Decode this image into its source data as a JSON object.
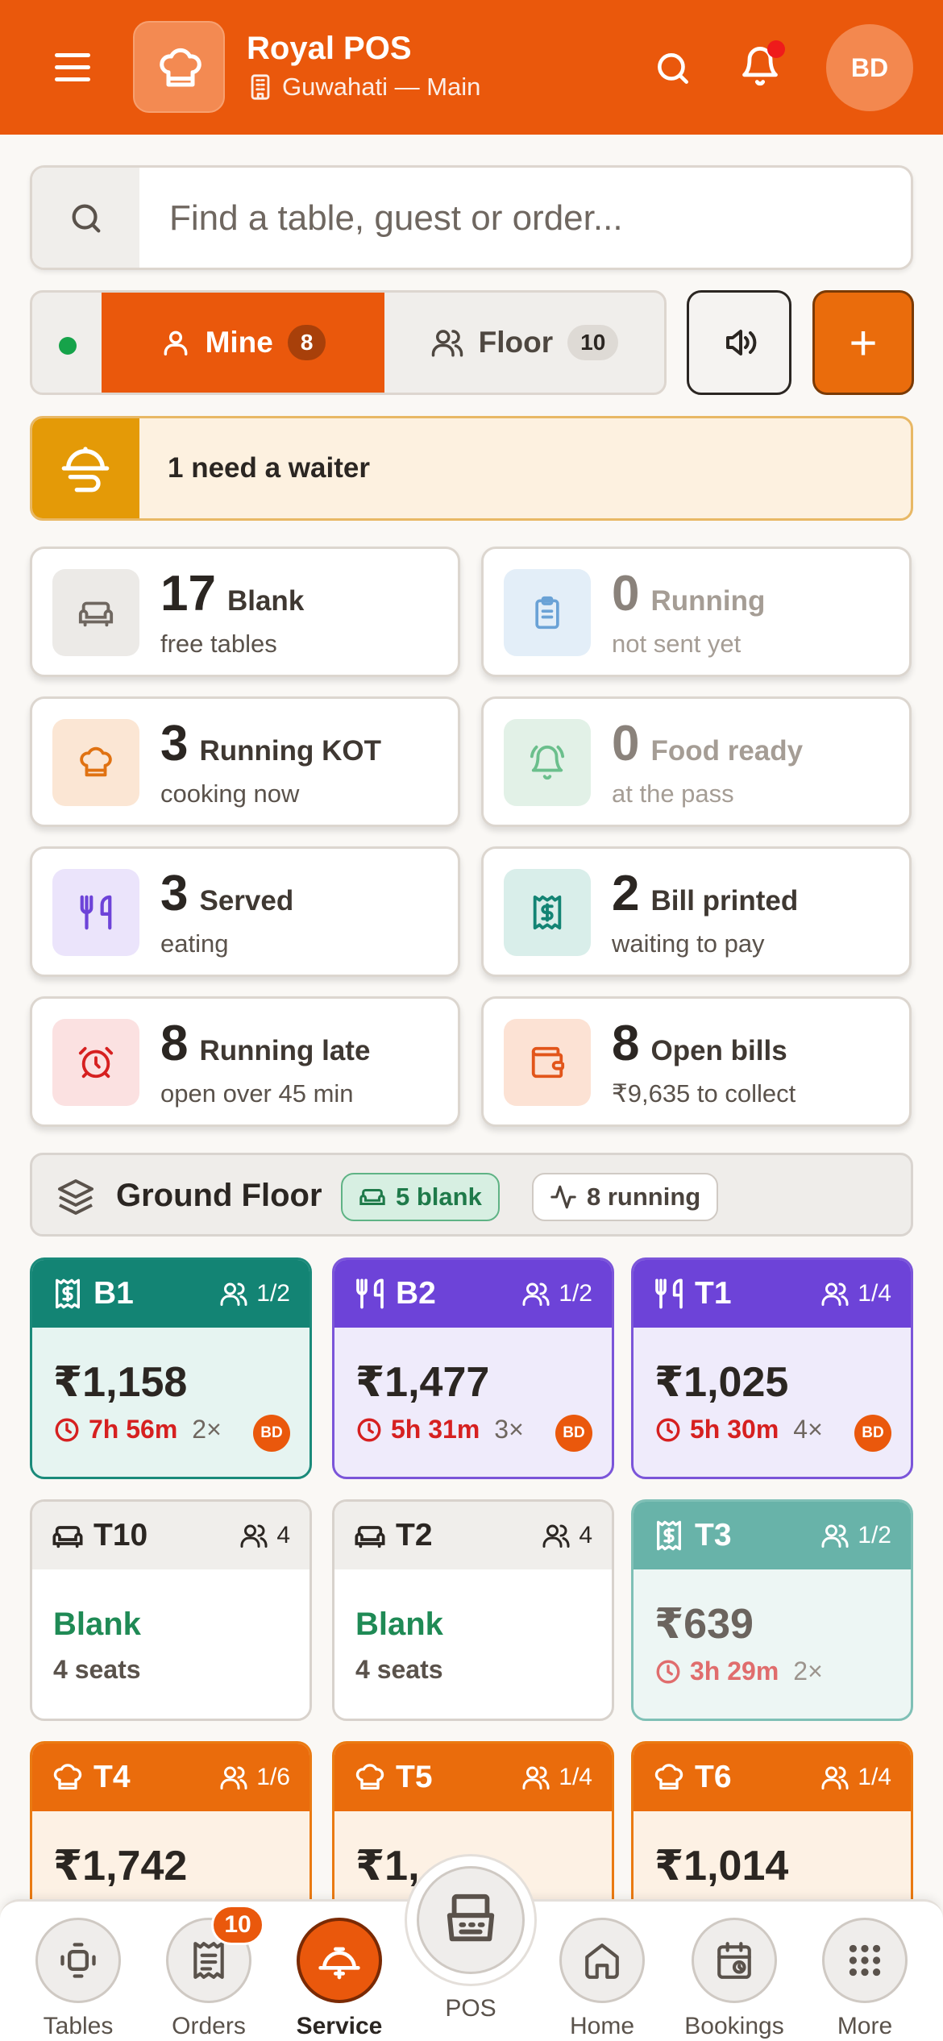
{
  "header": {
    "app_name": "Royal POS",
    "location": "Guwahati — Main",
    "avatar_initials": "BD",
    "brand_color": "#ea580c"
  },
  "search": {
    "placeholder": "Find a table, guest or order..."
  },
  "segments": {
    "mine": {
      "label": "Mine",
      "count": "8"
    },
    "floor": {
      "label": "Floor",
      "count": "10"
    },
    "add_label": "+"
  },
  "alert": {
    "text": "1 need a waiter"
  },
  "stats": [
    {
      "num": "17",
      "label": "Blank",
      "sub": "free tables",
      "icon": "sofa-icon"
    },
    {
      "num": "0",
      "label": "Running",
      "sub": "not sent yet",
      "icon": "clipboard-icon"
    },
    {
      "num": "3",
      "label": "Running KOT",
      "sub": "cooking now",
      "icon": "chef-hat-icon"
    },
    {
      "num": "0",
      "label": "Food ready",
      "sub": "at the pass",
      "icon": "bell-icon"
    },
    {
      "num": "3",
      "label": "Served",
      "sub": "eating",
      "icon": "utensils-icon"
    },
    {
      "num": "2",
      "label": "Bill printed",
      "sub": "waiting to pay",
      "icon": "receipt-icon"
    },
    {
      "num": "8",
      "label": "Running late",
      "sub": "open over 45 min",
      "icon": "alarm-icon"
    },
    {
      "num": "8",
      "label": "Open bills",
      "sub": "₹9,635 to collect",
      "icon": "wallet-icon"
    }
  ],
  "floor": {
    "name": "Ground Floor",
    "blank_badge": "5 blank",
    "running_badge": "8 running"
  },
  "tables": [
    {
      "name": "B1",
      "occupancy": "1/2",
      "amount": "₹1,158",
      "time": "7h 56m",
      "kots": "2×",
      "waiter": "BD",
      "state": "bill"
    },
    {
      "name": "B2",
      "occupancy": "1/2",
      "amount": "₹1,477",
      "time": "5h 31m",
      "kots": "3×",
      "waiter": "BD",
      "state": "served"
    },
    {
      "name": "T1",
      "occupancy": "1/4",
      "amount": "₹1,025",
      "time": "5h 30m",
      "kots": "4×",
      "waiter": "BD",
      "state": "served"
    },
    {
      "name": "T10",
      "occupancy": "4",
      "status": "Blank",
      "seats": "4 seats",
      "state": "blank"
    },
    {
      "name": "T2",
      "occupancy": "4",
      "status": "Blank",
      "seats": "4 seats",
      "state": "blank"
    },
    {
      "name": "T3",
      "occupancy": "1/2",
      "amount": "₹639",
      "time": "3h 29m",
      "kots": "2×",
      "state": "bill-light"
    },
    {
      "name": "T4",
      "occupancy": "1/6",
      "amount": "₹1,742",
      "state": "kot"
    },
    {
      "name": "T5",
      "occupancy": "1/4",
      "amount": "₹1,",
      "state": "kot"
    },
    {
      "name": "T6",
      "occupancy": "1/4",
      "amount": "₹1,014",
      "state": "kot"
    }
  ],
  "bottom_nav": {
    "tables": "Tables",
    "orders": "Orders",
    "orders_badge": "10",
    "service": "Service",
    "pos": "POS",
    "home": "Home",
    "bookings": "Bookings",
    "more": "More"
  }
}
